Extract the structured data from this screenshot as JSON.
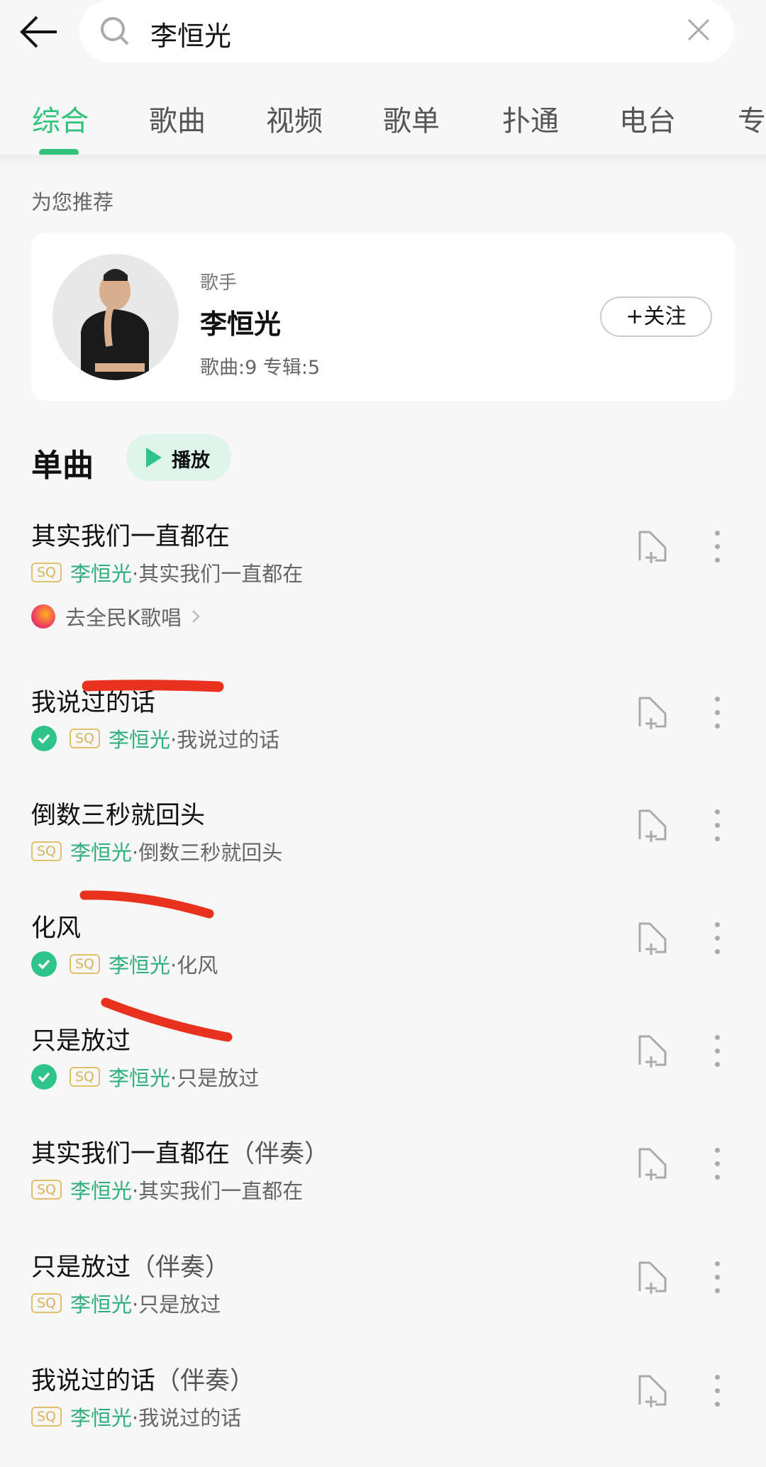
{
  "search": {
    "query": "李恒光"
  },
  "tabs": [
    "综合",
    "歌曲",
    "视频",
    "歌单",
    "扑通",
    "电台",
    "专"
  ],
  "active_tab": "综合",
  "recommend_label": "为您推荐",
  "artist_card": {
    "role": "歌手",
    "name": "李恒光",
    "stats": "歌曲:9 专辑:5",
    "follow_label": "+关注"
  },
  "section": {
    "title": "单曲",
    "play_label": "播放"
  },
  "colors": {
    "accent": "#31c27c",
    "annotation": "#e8321e"
  },
  "songs": [
    {
      "title": "其实我们一直都在",
      "suffix": "",
      "downloaded": false,
      "quality": "SQ",
      "artist": "李恒光",
      "album": "·其实我们一直都在",
      "karaoke": "去全民K歌唱"
    },
    {
      "title": "我说过的话",
      "suffix": "",
      "downloaded": true,
      "quality": "SQ",
      "artist": "李恒光",
      "album": "·我说过的话"
    },
    {
      "title": "倒数三秒就回头",
      "suffix": "",
      "downloaded": false,
      "quality": "SQ",
      "artist": "李恒光",
      "album": "·倒数三秒就回头"
    },
    {
      "title": "化风",
      "suffix": "",
      "downloaded": true,
      "quality": "SQ",
      "artist": "李恒光",
      "album": "·化风"
    },
    {
      "title": "只是放过",
      "suffix": "",
      "downloaded": true,
      "quality": "SQ",
      "artist": "李恒光",
      "album": "·只是放过"
    },
    {
      "title": "其实我们一直都在",
      "suffix": "（伴奏）",
      "downloaded": false,
      "quality": "SQ",
      "artist": "李恒光",
      "album": "·其实我们一直都在"
    },
    {
      "title": "只是放过",
      "suffix": "（伴奏）",
      "downloaded": false,
      "quality": "SQ",
      "artist": "李恒光",
      "album": "·只是放过"
    },
    {
      "title": "我说过的话",
      "suffix": "（伴奏）",
      "downloaded": false,
      "quality": "SQ",
      "artist": "李恒光",
      "album": "·我说过的话"
    }
  ]
}
